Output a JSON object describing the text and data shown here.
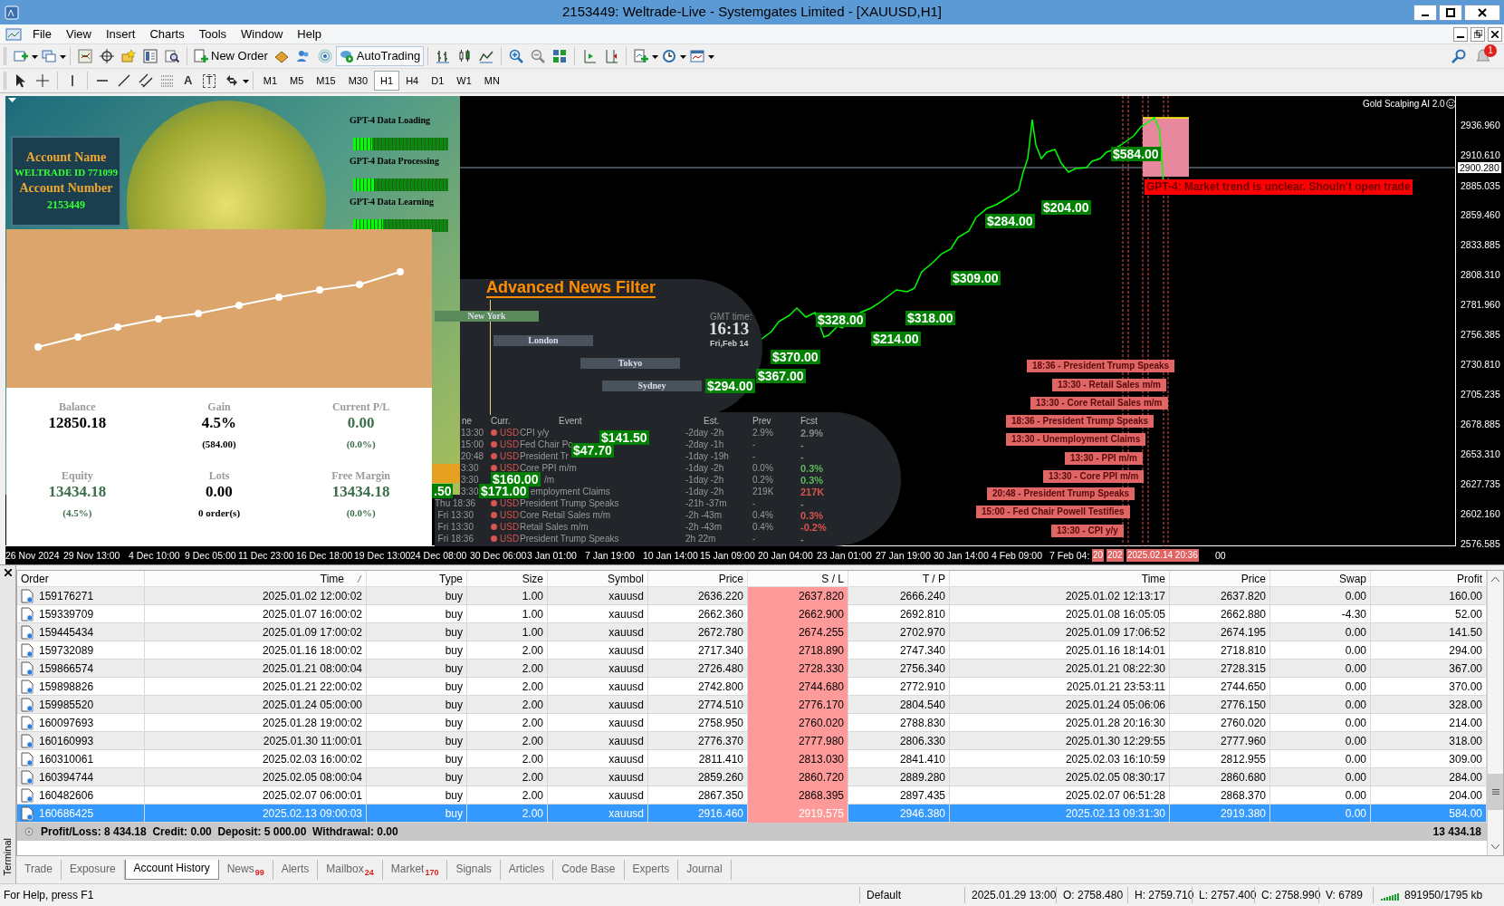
{
  "window": {
    "title": "2153449: Weltrade-Live - Systemgates Limited - [XAUUSD,H1]"
  },
  "menu": [
    "File",
    "View",
    "Insert",
    "Charts",
    "Tools",
    "Window",
    "Help"
  ],
  "toolbar": {
    "new_order": "New Order",
    "autotrading": "AutoTrading",
    "notification_count": "1",
    "text_tool": "A",
    "label_tool": "T"
  },
  "timeframes": [
    {
      "label": "M1",
      "selected": false
    },
    {
      "label": "M5",
      "selected": false
    },
    {
      "label": "M15",
      "selected": false
    },
    {
      "label": "M30",
      "selected": false
    },
    {
      "label": "H1",
      "selected": true
    },
    {
      "label": "H4",
      "selected": false
    },
    {
      "label": "D1",
      "selected": false
    },
    {
      "label": "W1",
      "selected": false
    },
    {
      "label": "MN",
      "selected": false
    }
  ],
  "chart": {
    "indicator_label": "Gold Scalping AI 2.0",
    "account_panel": {
      "account_name_label": "Account Name",
      "account_id": "WELTRADE ID 771099",
      "account_number_label": "Account Number",
      "account_number": "2153449",
      "loaders": [
        {
          "label": "GPT-4 Data Loading",
          "level": 0.2
        },
        {
          "label": "GPT-4 Data Processing",
          "level": 0.23
        },
        {
          "label": "GPT-4 Data Learning",
          "level": 0.31
        }
      ],
      "stats": [
        {
          "label": "Balance",
          "value": "12850.18",
          "color": "#000000"
        },
        {
          "label": "Gain",
          "value": "4.5%",
          "sub": "(584.00)",
          "color": "#000000"
        },
        {
          "label": "Current P/L",
          "value": "0.00",
          "sub": "(0.0%)",
          "color": "#3d6e4b"
        },
        {
          "label": "Equity",
          "value": "13434.18",
          "sub": "(4.5%)",
          "color": "#3d6e4b"
        },
        {
          "label": "Lots",
          "value": "0.00",
          "sub": "0 order(s)",
          "color": "#000000"
        },
        {
          "label": "Free Margin",
          "value": "13434.18",
          "sub": "(0.0%)",
          "color": "#3d6e4b"
        }
      ]
    },
    "news_filter": {
      "title": "Advanced News Filter",
      "sessions": [
        "New York",
        "London",
        "Tokyo",
        "Sydney"
      ],
      "gmt_label": "GMT time:",
      "gmt_time": "16:13",
      "gmt_date": "Fri,Feb 14",
      "columns": [
        "ne",
        "Curr.",
        "Event",
        "Est.",
        "Prev",
        "Fcst"
      ],
      "rows": [
        {
          "time": "13:30",
          "currency": "USD",
          "event": "CPI y/y",
          "est": "-2day -2h",
          "prev": "2.9%",
          "fcst": "2.9%",
          "color": "#8a8a8a"
        },
        {
          "time": "15:00",
          "currency": "USD",
          "event": "Fed Chair Po",
          "est": "-2day -1h",
          "prev": "-",
          "fcst": "-"
        },
        {
          "time": "20:48",
          "currency": "USD",
          "event": "President Tr",
          "est": "-1day -19h",
          "prev": "-",
          "fcst": "-"
        },
        {
          "time": "3:30",
          "currency": "USD",
          "event": "Core PPI m/m",
          "est": "-1day -2h",
          "prev": "0.0%",
          "fcst": "0.3%",
          "color": "#5cb85c"
        },
        {
          "time": "3:30",
          "event": "/m",
          "est": "-1day -2h",
          "prev": "0.2%",
          "fcst": "0.3%",
          "color": "#5cb85c"
        },
        {
          "time": "3:30",
          "event": "employment Claims",
          "est": "-1day -2h",
          "prev": "219K",
          "fcst": "217K",
          "color": "#d9534f"
        },
        {
          "time": "Thu 18:36",
          "currency": "USD",
          "event": "President Trump Speaks",
          "est": "-21h -37m",
          "prev": "-",
          "fcst": "-"
        },
        {
          "time": "Fri 13:30",
          "currency": "USD",
          "event": "Core Retail Sales m/m",
          "est": "-2h -43m",
          "prev": "0.4%",
          "fcst": "0.3%",
          "color": "#d9534f"
        },
        {
          "time": "Fri 13:30",
          "currency": "USD",
          "event": "Retail Sales m/m",
          "est": "-2h -43m",
          "prev": "0.4%",
          "fcst": "-0.2%",
          "color": "#d9534f"
        },
        {
          "time": "Fri 18:36",
          "currency": "USD",
          "event": "President Trump Speaks",
          "est": "2h 22m",
          "prev": "-",
          "fcst": "-"
        }
      ]
    },
    "profit_labels": [
      "$141.50",
      "$47.70",
      "$160.00",
      "$171.00",
      ".50",
      "$294.00",
      "$367.00",
      "$370.00",
      "$328.00",
      "$214.00",
      "$318.00",
      "$309.00",
      "$284.00",
      "$204.00",
      "$584.00"
    ],
    "signal_message": "GPT-4: Market trend is unclear. Shouln't open trade",
    "event_labels": [
      "18:36 - President Trump Speaks",
      "13:30 - Retail Sales m/m",
      "13:30 - Core Retail Sales m/m",
      "18:36 - President Trump Speaks",
      "13:30 - Unemployment Claims",
      "13:30 - PPI m/m",
      "13:30 - Core PPI m/m",
      "20:48 - President Trump Speaks",
      "15:00 - Fed Chair Powell Testifies",
      "13:30 - CPI y/y"
    ],
    "price_axis": [
      "2936.960",
      "2910.610",
      "2885.035",
      "2859.460",
      "2833.885",
      "2808.310",
      "2781.960",
      "2756.385",
      "2730.810",
      "2705.235",
      "2678.885",
      "2653.310",
      "2627.735",
      "2602.160",
      "2576.585"
    ],
    "current_price": "2900.280",
    "time_axis": [
      "26 Nov 2024",
      "29 Nov 13:00",
      "4 Dec 10:00",
      "9 Dec 05:00",
      "11 Dec 23:00",
      "16 Dec 18:00",
      "19 Dec 13:00",
      "24 Dec 08:00",
      "30 Dec 06:00",
      "3 Jan 01:00",
      "7 Jan 19:00",
      "10 Jan 14:00",
      "15 Jan 09:00",
      "20 Jan 04:00",
      "23 Jan 01:00",
      "27 Jan 19:00",
      "30 Jan 14:00",
      "4 Feb 09:00",
      "7 Feb 04:",
      "00"
    ],
    "time_markers": [
      "20",
      "202",
      "2025.02.14 20:36"
    ]
  },
  "terminal": {
    "label": "Terminal",
    "columns": [
      "Order",
      "Time",
      "Type",
      "Size",
      "Symbol",
      "Price",
      "S / L",
      "T / P",
      "Time",
      "Price",
      "Swap",
      "Profit"
    ],
    "rows": [
      {
        "order": "159176271",
        "time": "2025.01.02 12:00:02",
        "type": "buy",
        "size": "1.00",
        "symbol": "xauusd",
        "price": "2636.220",
        "sl": "2637.820",
        "tp": "2666.240",
        "close_time": "2025.01.02 12:13:17",
        "close_price": "2637.820",
        "swap": "0.00",
        "profit": "160.00",
        "selected": false
      },
      {
        "order": "159339709",
        "time": "2025.01.07 16:00:02",
        "type": "buy",
        "size": "1.00",
        "symbol": "xauusd",
        "price": "2662.360",
        "sl": "2662.900",
        "tp": "2692.810",
        "close_time": "2025.01.08 16:05:05",
        "close_price": "2662.880",
        "swap": "-4.30",
        "profit": "52.00",
        "selected": false
      },
      {
        "order": "159445434",
        "time": "2025.01.09 17:00:02",
        "type": "buy",
        "size": "1.00",
        "symbol": "xauusd",
        "price": "2672.780",
        "sl": "2674.255",
        "tp": "2702.970",
        "close_time": "2025.01.09 17:06:52",
        "close_price": "2674.195",
        "swap": "0.00",
        "profit": "141.50",
        "selected": false
      },
      {
        "order": "159732089",
        "time": "2025.01.16 18:00:02",
        "type": "buy",
        "size": "2.00",
        "symbol": "xauusd",
        "price": "2717.340",
        "sl": "2718.890",
        "tp": "2747.340",
        "close_time": "2025.01.16 18:14:01",
        "close_price": "2718.810",
        "swap": "0.00",
        "profit": "294.00",
        "selected": false
      },
      {
        "order": "159866574",
        "time": "2025.01.21 08:00:04",
        "type": "buy",
        "size": "2.00",
        "symbol": "xauusd",
        "price": "2726.480",
        "sl": "2728.330",
        "tp": "2756.340",
        "close_time": "2025.01.21 08:22:30",
        "close_price": "2728.315",
        "swap": "0.00",
        "profit": "367.00",
        "selected": false
      },
      {
        "order": "159898826",
        "time": "2025.01.21 22:00:02",
        "type": "buy",
        "size": "2.00",
        "symbol": "xauusd",
        "price": "2742.800",
        "sl": "2744.680",
        "tp": "2772.910",
        "close_time": "2025.01.21 23:53:11",
        "close_price": "2744.650",
        "swap": "0.00",
        "profit": "370.00",
        "selected": false
      },
      {
        "order": "159985520",
        "time": "2025.01.24 05:00:00",
        "type": "buy",
        "size": "2.00",
        "symbol": "xauusd",
        "price": "2774.510",
        "sl": "2776.170",
        "tp": "2804.540",
        "close_time": "2025.01.24 05:06:06",
        "close_price": "2776.150",
        "swap": "0.00",
        "profit": "328.00",
        "selected": false
      },
      {
        "order": "160097693",
        "time": "2025.01.28 19:00:02",
        "type": "buy",
        "size": "2.00",
        "symbol": "xauusd",
        "price": "2758.950",
        "sl": "2760.020",
        "tp": "2788.830",
        "close_time": "2025.01.28 20:16:30",
        "close_price": "2760.020",
        "swap": "0.00",
        "profit": "214.00",
        "selected": false
      },
      {
        "order": "160160993",
        "time": "2025.01.30 11:00:01",
        "type": "buy",
        "size": "2.00",
        "symbol": "xauusd",
        "price": "2776.370",
        "sl": "2777.980",
        "tp": "2806.330",
        "close_time": "2025.01.30 12:29:55",
        "close_price": "2777.960",
        "swap": "0.00",
        "profit": "318.00",
        "selected": false
      },
      {
        "order": "160310061",
        "time": "2025.02.03 16:00:02",
        "type": "buy",
        "size": "2.00",
        "symbol": "xauusd",
        "price": "2811.410",
        "sl": "2813.030",
        "tp": "2841.410",
        "close_time": "2025.02.03 16:10:59",
        "close_price": "2812.955",
        "swap": "0.00",
        "profit": "309.00",
        "selected": false
      },
      {
        "order": "160394744",
        "time": "2025.02.05 08:00:04",
        "type": "buy",
        "size": "2.00",
        "symbol": "xauusd",
        "price": "2859.260",
        "sl": "2860.720",
        "tp": "2889.280",
        "close_time": "2025.02.05 08:30:17",
        "close_price": "2860.680",
        "swap": "0.00",
        "profit": "284.00",
        "selected": false
      },
      {
        "order": "160482606",
        "time": "2025.02.07 06:00:01",
        "type": "buy",
        "size": "2.00",
        "symbol": "xauusd",
        "price": "2867.350",
        "sl": "2868.395",
        "tp": "2897.435",
        "close_time": "2025.02.07 06:51:28",
        "close_price": "2868.370",
        "swap": "0.00",
        "profit": "204.00",
        "selected": false
      },
      {
        "order": "160686425",
        "time": "2025.02.13 09:00:03",
        "type": "buy",
        "size": "2.00",
        "symbol": "xauusd",
        "price": "2916.460",
        "sl": "2919.575",
        "tp": "2946.380",
        "close_time": "2025.02.13 09:31:30",
        "close_price": "2919.380",
        "swap": "0.00",
        "profit": "584.00",
        "selected": true
      }
    ],
    "summary": {
      "text": "Profit/Loss: 8 434.18  Credit: 0.00  Deposit: 5 000.00  Withdrawal: 0.00",
      "total": "13 434.18"
    },
    "tabs": [
      {
        "label": "Trade",
        "selected": false
      },
      {
        "label": "Exposure",
        "selected": false
      },
      {
        "label": "Account History",
        "selected": true
      },
      {
        "label": "News",
        "badge": "99",
        "selected": false
      },
      {
        "label": "Alerts",
        "selected": false
      },
      {
        "label": "Mailbox",
        "badge": "24",
        "selected": false
      },
      {
        "label": "Market",
        "badge": "170",
        "selected": false
      },
      {
        "label": "Signals",
        "selected": false
      },
      {
        "label": "Articles",
        "selected": false
      },
      {
        "label": "Code Base",
        "selected": false
      },
      {
        "label": "Experts",
        "selected": false
      },
      {
        "label": "Journal",
        "selected": false
      }
    ]
  },
  "status_bar": {
    "help": "For Help, press F1",
    "profile": "Default",
    "fields": [
      "2025.01.29 13:00",
      "O: 2758.480",
      "H: 2759.710",
      "L: 2757.400",
      "C: 2758.990",
      "V: 6789"
    ],
    "connection": "891950/1795 kb"
  }
}
